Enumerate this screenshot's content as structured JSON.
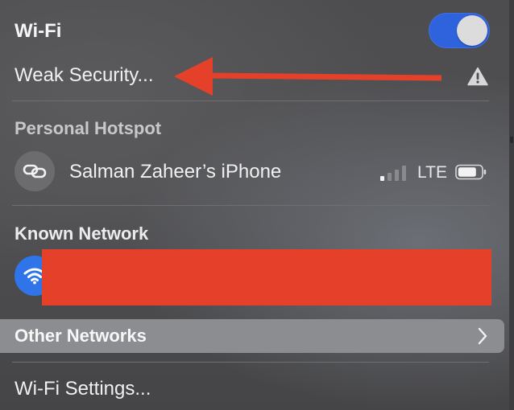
{
  "wifi": {
    "title": "Wi-Fi",
    "toggle_on": true,
    "toggle_color": "#2f63de"
  },
  "current_network": {
    "status_label": "Weak Security...",
    "warning_icon": "warning-triangle-icon"
  },
  "annotation": {
    "arrow_color": "#e5402a"
  },
  "personal_hotspot": {
    "heading": "Personal Hotspot",
    "device_name": "Salman Zaheer’s iPhone",
    "network_type": "LTE",
    "icon": "link-icon",
    "signal_bars_active": 1,
    "signal_bars_total": 4
  },
  "known_network": {
    "heading": "Known Network",
    "icon": "wifi-icon",
    "redaction_color": "#e5402a"
  },
  "other_networks": {
    "label": "Other Networks",
    "icon": "chevron-right-icon"
  },
  "settings": {
    "label": "Wi-Fi Settings..."
  }
}
